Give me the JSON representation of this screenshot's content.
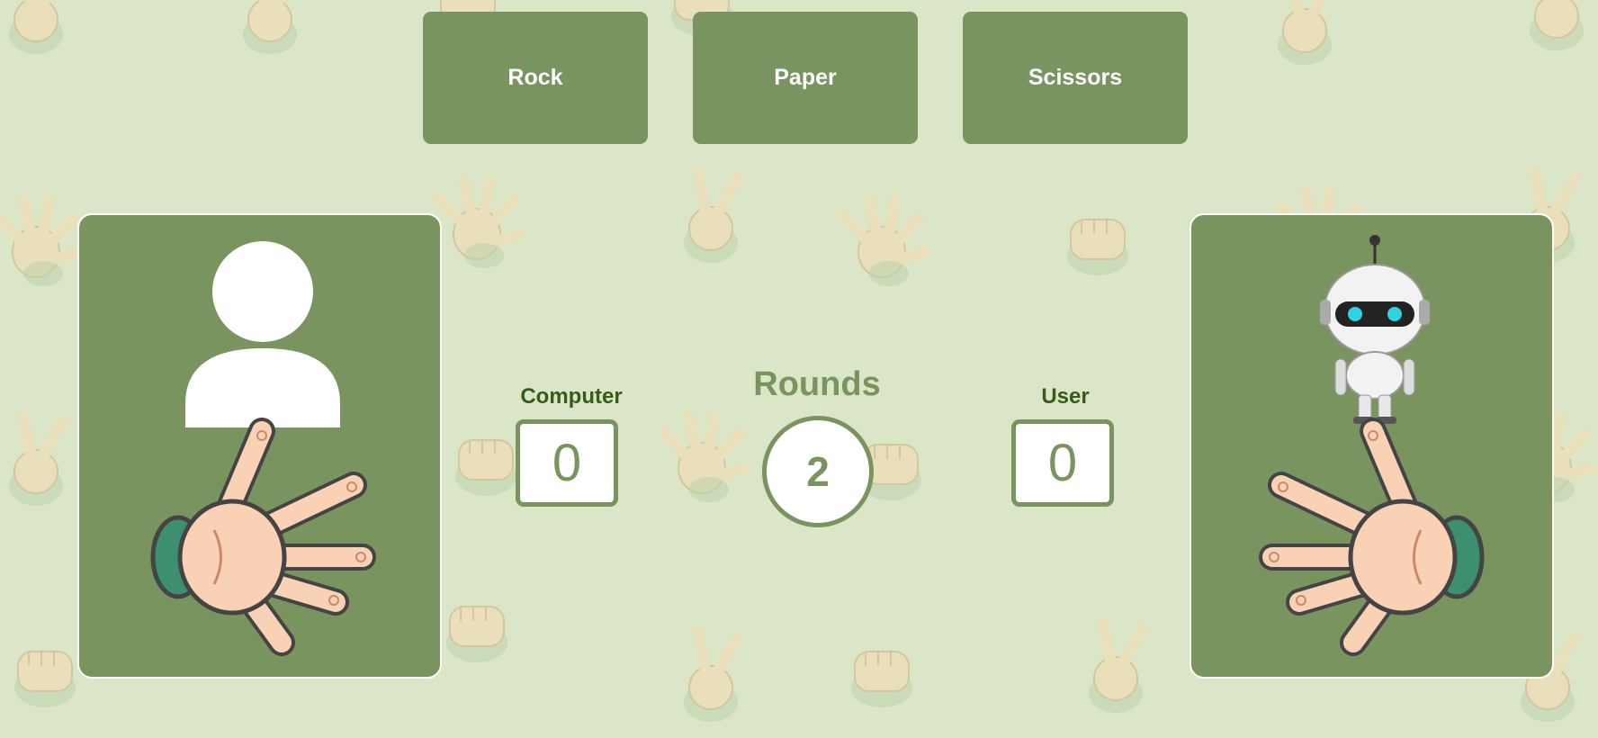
{
  "choices": [
    {
      "label": "Rock"
    },
    {
      "label": "Paper"
    },
    {
      "label": "Scissors"
    }
  ],
  "scoreboard": {
    "computer_label": "Computer",
    "computer_score": "0",
    "user_label": "User",
    "user_score": "0",
    "rounds_label": "Rounds",
    "rounds_value": "2"
  },
  "players": {
    "left": {
      "avatar": "user-silhouette-icon",
      "hand": "paper-hand-icon"
    },
    "right": {
      "avatar": "robot-icon",
      "hand": "paper-hand-icon"
    }
  },
  "colors": {
    "background": "#dbe6c8",
    "accent": "#79945f",
    "label_dark": "#365c17",
    "white": "#ffffff"
  }
}
